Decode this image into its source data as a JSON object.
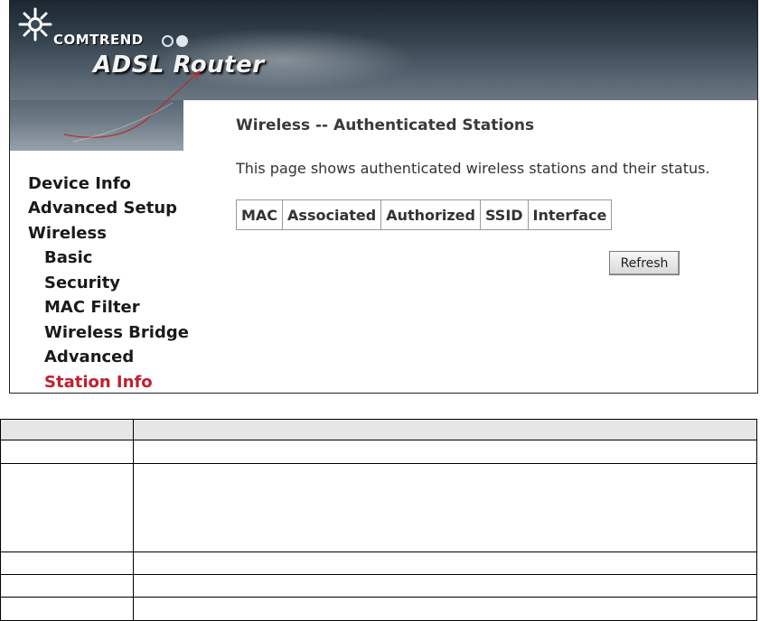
{
  "header": {
    "brand": "COMTREND",
    "product": "ADSL Router"
  },
  "sidebar": {
    "items": [
      {
        "label": "Device Info",
        "level": 0,
        "active": false
      },
      {
        "label": "Advanced Setup",
        "level": 0,
        "active": false
      },
      {
        "label": "Wireless",
        "level": 0,
        "active": false
      },
      {
        "label": "Basic",
        "level": 1,
        "active": false
      },
      {
        "label": "Security",
        "level": 1,
        "active": false
      },
      {
        "label": "MAC Filter",
        "level": 1,
        "active": false
      },
      {
        "label": "Wireless Bridge",
        "level": 1,
        "active": false
      },
      {
        "label": "Advanced",
        "level": 1,
        "active": false
      },
      {
        "label": "Station Info",
        "level": 1,
        "active": true
      }
    ],
    "active_color": "#c0202e"
  },
  "main": {
    "title": "Wireless -- Authenticated Stations",
    "description": "This page shows authenticated wireless stations and their status.",
    "table": {
      "columns": [
        "MAC",
        "Associated",
        "Authorized",
        "SSID",
        "Interface"
      ]
    },
    "refresh_label": "Refresh"
  },
  "icons": {
    "logo": "comtrend-sunburst-logo"
  }
}
